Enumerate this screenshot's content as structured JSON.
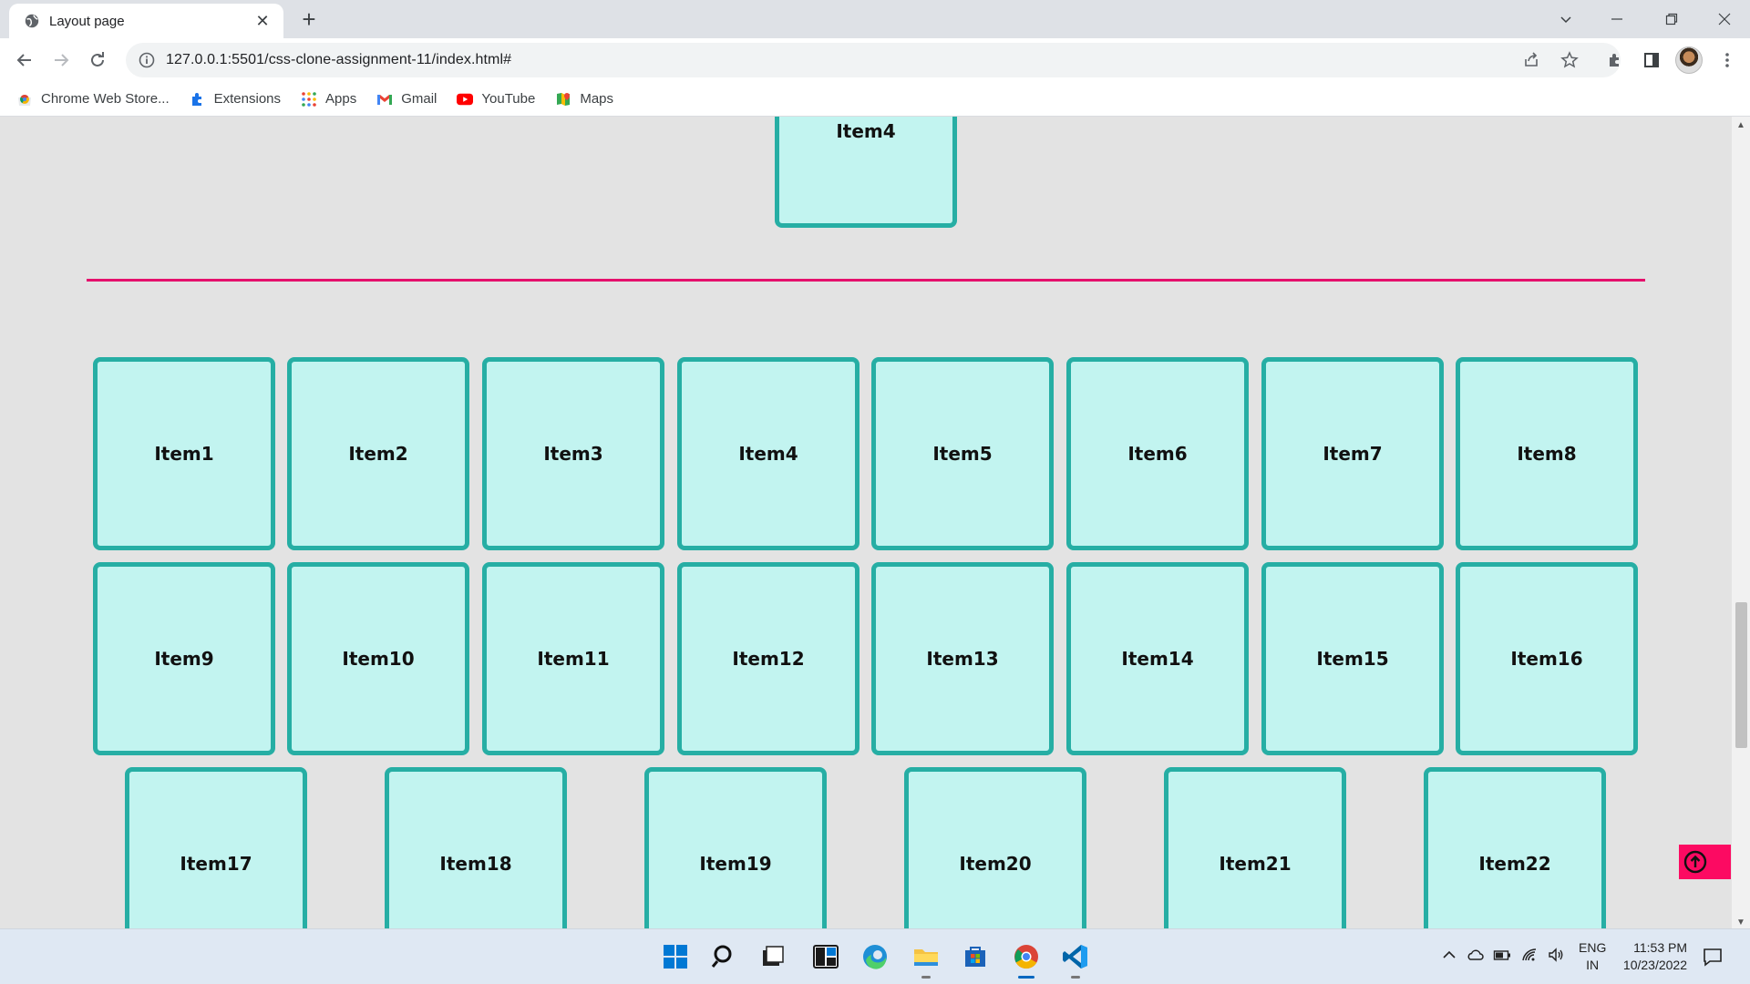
{
  "browser": {
    "tab_title": "Layout page",
    "url": "127.0.0.1:5501/css-clone-assignment-11/index.html#",
    "bookmarks": [
      {
        "label": "Chrome Web Store...",
        "icon": "chrome-web-store-icon"
      },
      {
        "label": "Extensions",
        "icon": "puzzle-icon"
      },
      {
        "label": "Apps",
        "icon": "apps-grid-icon"
      },
      {
        "label": "Gmail",
        "icon": "gmail-icon"
      },
      {
        "label": "YouTube",
        "icon": "youtube-icon"
      },
      {
        "label": "Maps",
        "icon": "maps-icon"
      }
    ]
  },
  "page": {
    "top_item": "Item4",
    "row1": [
      "Item1",
      "Item2",
      "Item3",
      "Item4",
      "Item5",
      "Item6",
      "Item7",
      "Item8"
    ],
    "row2": [
      "Item9",
      "Item10",
      "Item11",
      "Item12",
      "Item13",
      "Item14",
      "Item15",
      "Item16"
    ],
    "row3": [
      "Item17",
      "Item18",
      "Item19",
      "Item20",
      "Item21",
      "Item22"
    ],
    "colors": {
      "box_bg": "#c2f4f0",
      "box_border": "#26aea4",
      "divider": "#e5106c",
      "scroll_top_button": "#fc0a62"
    }
  },
  "taskbar": {
    "language": "ENG",
    "region": "IN",
    "time": "11:53 PM",
    "date": "10/23/2022"
  }
}
